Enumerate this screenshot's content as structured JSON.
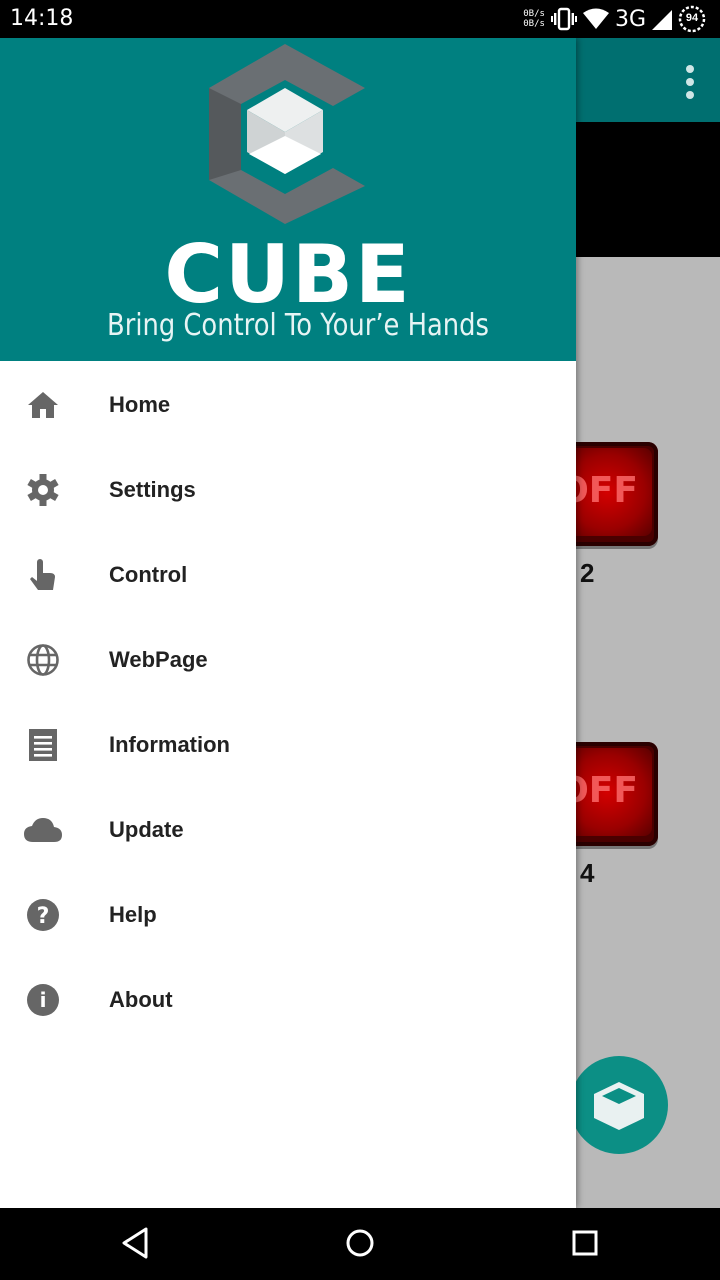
{
  "status_bar": {
    "time": "14:18",
    "net_up": "0B/s",
    "net_down": "0B/s",
    "network": "3G",
    "battery": "94"
  },
  "drawer": {
    "brand": "CUBE",
    "tagline": "Bring Control To Your’e Hands",
    "items": [
      {
        "label": "Home",
        "icon": "home-icon"
      },
      {
        "label": "Settings",
        "icon": "gear-icon"
      },
      {
        "label": "Control",
        "icon": "touch-icon"
      },
      {
        "label": "WebPage",
        "icon": "globe-icon"
      },
      {
        "label": "Information",
        "icon": "receipt-icon"
      },
      {
        "label": "Update",
        "icon": "cloud-icon"
      },
      {
        "label": "Help",
        "icon": "help-icon"
      },
      {
        "label": "About",
        "icon": "info-icon"
      }
    ]
  },
  "background_app": {
    "buttons": [
      {
        "label": "OFF",
        "number": "2"
      },
      {
        "label": "OFF",
        "number": "4"
      }
    ]
  },
  "colors": {
    "header": "#008080",
    "toolbar": "#006f70",
    "icon": "#666666"
  }
}
